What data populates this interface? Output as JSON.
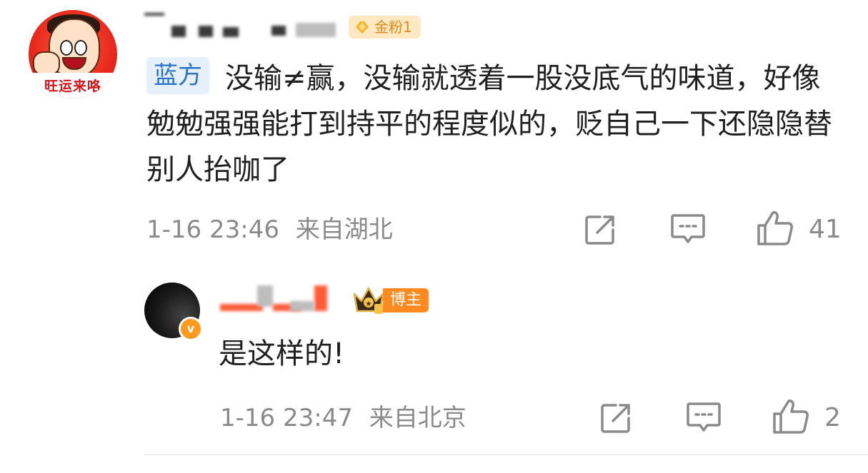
{
  "comment": {
    "avatar_text": "旺运来咯",
    "badge_label": "金粉1",
    "topic_tag": "蓝方",
    "text": "没输≠赢，没输就透着一股没底气的味道，好像勉勉强强能打到持平的程度似的，贬自己一下还隐隐替别人抬咖了",
    "time": "1-16 23:46",
    "location": "来自湖北",
    "like_count": "41",
    "icons": [
      "share-icon",
      "comment-icon",
      "like-icon"
    ]
  },
  "reply": {
    "verified_mark": "v",
    "badge_label": "博主",
    "text": "是这样的!",
    "time": "1-16 23:47",
    "location": "来自北京",
    "like_count": "2",
    "icons": [
      "share-icon",
      "comment-icon",
      "like-icon"
    ]
  },
  "colors": {
    "topic_blue": "#2a73c6",
    "gold_badge": "#d98b18",
    "boss_badge": "#ff8a1f",
    "meta_gray": "#8a8a8a"
  }
}
